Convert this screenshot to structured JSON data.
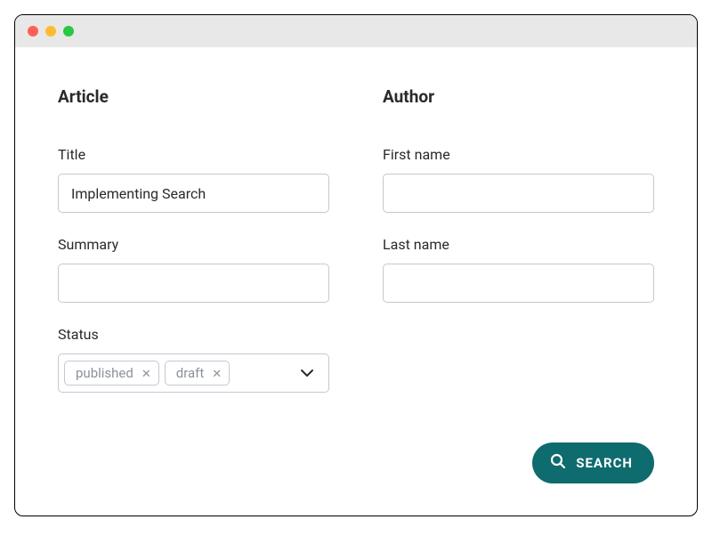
{
  "sections": {
    "article": {
      "heading": "Article",
      "title_label": "Title",
      "title_value": "Implementing Search",
      "summary_label": "Summary",
      "summary_value": "",
      "status_label": "Status",
      "status_tags": [
        "published",
        "draft"
      ]
    },
    "author": {
      "heading": "Author",
      "first_name_label": "First name",
      "first_name_value": "",
      "last_name_label": "Last name",
      "last_name_value": ""
    }
  },
  "actions": {
    "search_label": "SEARCH"
  },
  "colors": {
    "accent": "#0e6b6e"
  }
}
